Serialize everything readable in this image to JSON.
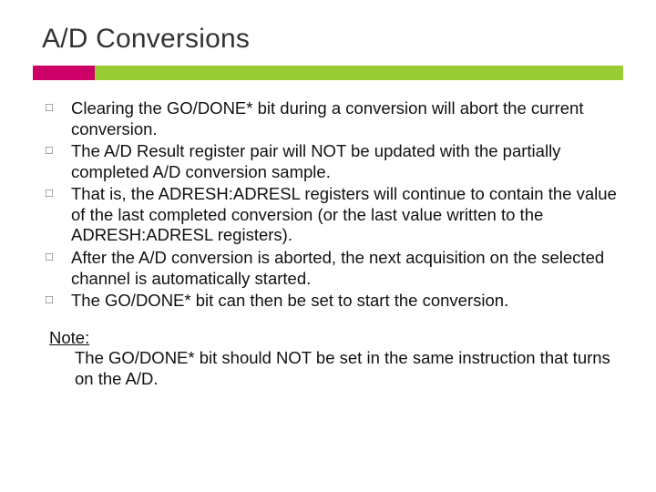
{
  "title": "A/D Conversions",
  "bullets": {
    "b0": "Clearing the GO/DONE* bit during a conversion will abort the current conversion.",
    "b1": "The A/D Result register pair will NOT be updated with the partially completed A/D conversion sample.",
    "b2": "That is, the ADRESH:ADRESL registers will continue to contain the value of the last completed conversion (or the last value written to the ADRESH:ADRESL registers).",
    "b3": "After the A/D conversion is aborted, the next acquisition on the selected channel is automatically started.",
    "b4": "The GO/DONE* bit can then be set to start the conversion."
  },
  "note": {
    "label": "Note:",
    "text": "The GO/DONE* bit should NOT be set in the same instruction that turns on the A/D."
  }
}
